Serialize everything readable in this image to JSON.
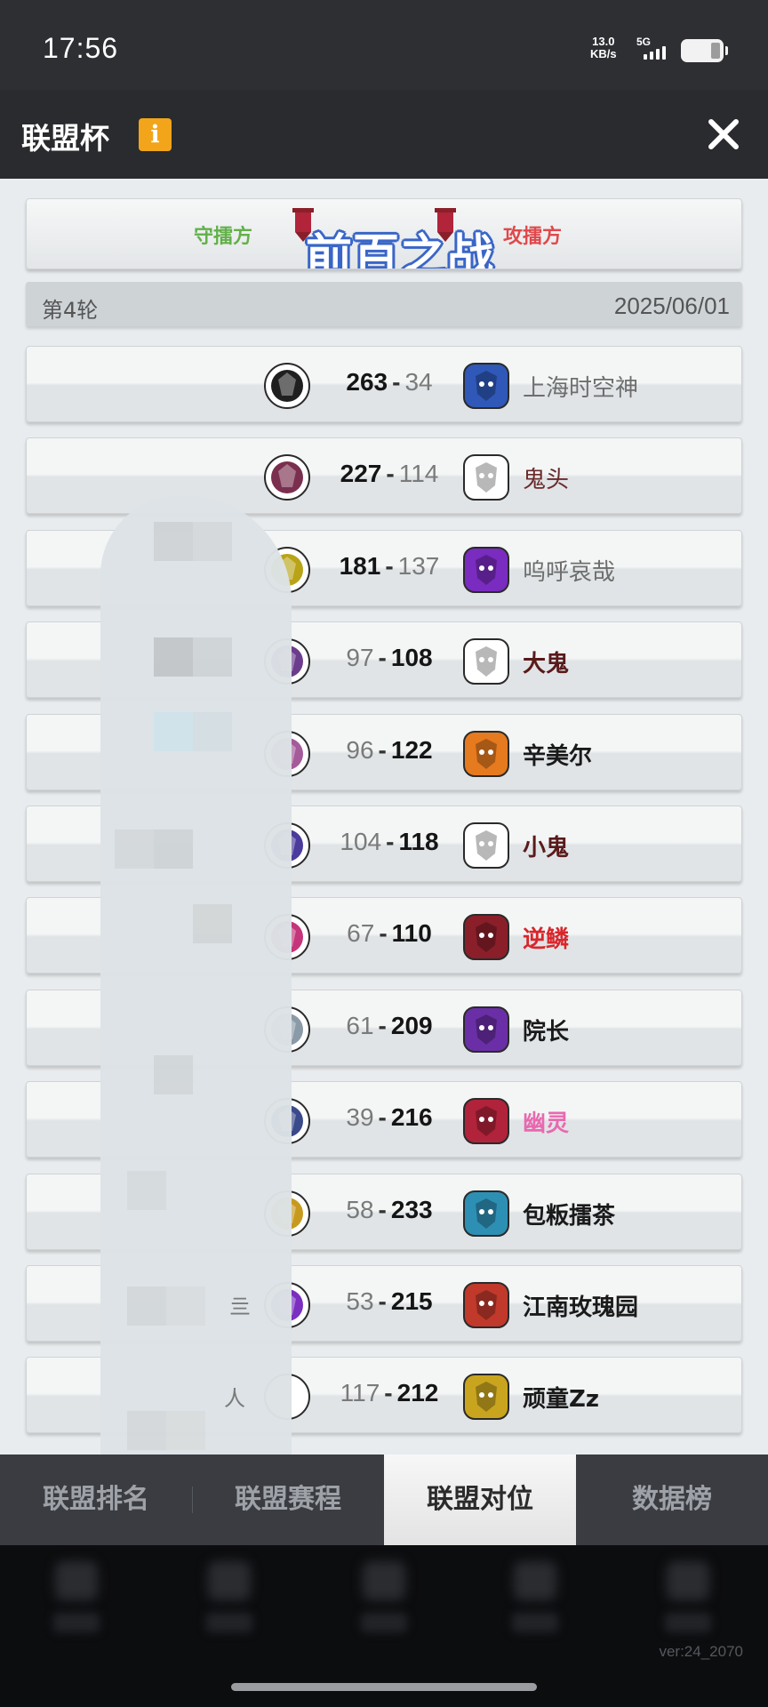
{
  "status_bar": {
    "time": "17:56",
    "net_speed_value": "13.0",
    "net_speed_unit": "KB/s",
    "network": "5G"
  },
  "header": {
    "title": "联盟杯",
    "info_icon": "i"
  },
  "banner": {
    "defender_label": "守擂方",
    "attacker_label": "攻擂方",
    "headline": "前百之战"
  },
  "round": {
    "label": "第4轮",
    "date": "2025/06/01"
  },
  "matches": [
    {
      "left_score": "263",
      "right_score": "34",
      "winner": "left",
      "right_team": "上海时空神",
      "name_style": "plain",
      "name_color": "#6e6e6e",
      "left_logo": "#1f1f1f",
      "right_logo": "#2f58b8"
    },
    {
      "left_score": "227",
      "right_score": "114",
      "winner": "left",
      "right_team": "鬼头",
      "name_style": "plain",
      "name_color": "#6b2a2a",
      "left_logo": "#7a2f4f",
      "right_logo": "#ffffff"
    },
    {
      "left_score": "181",
      "right_score": "137",
      "winner": "left",
      "right_team": "呜呼哀哉",
      "name_style": "plain",
      "name_color": "#6e6e6e",
      "left_logo": "#b9a317",
      "right_logo": "#7a2bc0"
    },
    {
      "left_score": "97",
      "right_score": "108",
      "winner": "right",
      "right_team": "大鬼",
      "name_style": "bold",
      "name_color": "#5a1a1a",
      "left_logo": "#6b3d8c",
      "right_logo": "#ffffff"
    },
    {
      "left_score": "96",
      "right_score": "122",
      "winner": "right",
      "right_team": "辛美尔",
      "name_style": "bold",
      "name_color": "#1a1a1a",
      "left_logo": "#a55a9a",
      "right_logo": "#e67a1f"
    },
    {
      "left_score": "104",
      "right_score": "118",
      "winner": "right",
      "right_team": "小鬼",
      "name_style": "bold",
      "name_color": "#5a1a1a",
      "left_logo": "#4a3b9c",
      "right_logo": "#ffffff"
    },
    {
      "left_score": "67",
      "right_score": "110",
      "winner": "right",
      "right_team": "逆鳞",
      "name_style": "bold",
      "name_color": "#d9262b",
      "left_logo": "#c4357a",
      "right_logo": "#8a1f2a"
    },
    {
      "left_score": "61",
      "right_score": "209",
      "winner": "right",
      "right_team": "院长",
      "name_style": "bold",
      "name_color": "#1a1a1a",
      "left_logo": "#8a9aa6",
      "right_logo": "#6a2fa6"
    },
    {
      "left_score": "39",
      "right_score": "216",
      "winner": "right",
      "right_team": "幽灵",
      "name_style": "bold",
      "name_color": "#e869b0",
      "left_logo": "#3a4a8a",
      "right_logo": "#b0233a"
    },
    {
      "left_score": "58",
      "right_score": "233",
      "winner": "right",
      "right_team": "包粄擂茶",
      "name_style": "bold",
      "name_color": "#1a1a1a",
      "left_logo": "#c79a1f",
      "right_logo": "#2e8fb5"
    },
    {
      "left_score": "53",
      "right_score": "215",
      "winner": "right",
      "right_team": "江南玫瑰园",
      "name_style": "bold",
      "name_color": "#1a1a1a",
      "left_logo": "#7a2fc0",
      "right_logo": "#c0392b"
    },
    {
      "left_score": "117",
      "right_score": "212",
      "winner": "right",
      "right_team": "顽童Zz",
      "name_style": "bold",
      "name_color": "#1a1a1a",
      "left_logo": "#ffffff",
      "right_logo": "#c9a51f"
    }
  ],
  "left_edge_fragments": [
    "亖",
    "人"
  ],
  "tabs": [
    {
      "label": "联盟排名",
      "active": false
    },
    {
      "label": "联盟赛程",
      "active": false
    },
    {
      "label": "联盟对位",
      "active": true
    },
    {
      "label": "数据榜",
      "active": false
    }
  ],
  "version": "ver:24_2070",
  "colors": {
    "defender": "#62b04a",
    "attacker": "#e0484b",
    "info_badge": "#f2a51a",
    "headline_outline": "#3a66c9"
  }
}
